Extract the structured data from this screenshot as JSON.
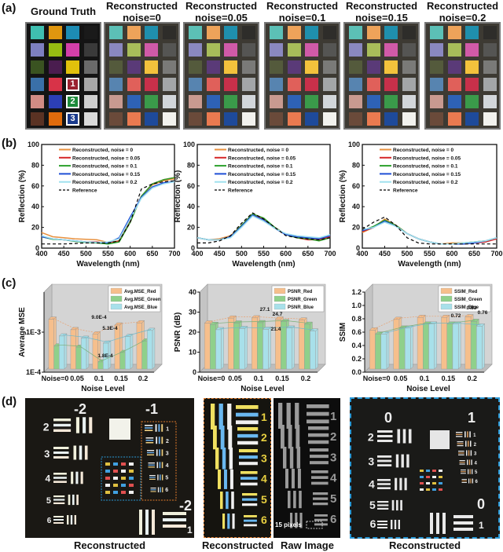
{
  "panels": {
    "a": {
      "label": "(a)",
      "headers": [
        {
          "line1": "Ground Truth",
          "line2": ""
        },
        {
          "line1": "Reconstructed",
          "line2": "noise=0"
        },
        {
          "line1": "Reconstructed",
          "line2": "noise=0.05"
        },
        {
          "line1": "Reconstructed",
          "line2": "noise=0.1"
        },
        {
          "line1": "Reconstructed",
          "line2": "noise=0.15"
        },
        {
          "line1": "Reconstructed",
          "line2": "noise=0.2"
        }
      ],
      "ground_truth_patches": [
        [
          "#3fbfb0",
          "#e0960f",
          "#1d8cb4",
          "#1a1a1a"
        ],
        [
          "#7d7fc0",
          "#96bd12",
          "#d33fa9",
          "#3a3a3a"
        ],
        [
          "#3a5321",
          "#4a1d4f",
          "#e1c10c",
          "#6a6a6a"
        ],
        [
          "#3a70a8",
          "#d83348",
          "#9a2230",
          "#a8a8a8"
        ],
        [
          "#d18b84",
          "#2c3fb5",
          "#1d8a3a",
          "#cfcfcf"
        ],
        [
          "#5a3223",
          "#e06b0c",
          "#1a3a8c",
          "#dadada"
        ]
      ],
      "reconstructed_patches": [
        [
          "#5cc0b6",
          "#eea35a",
          "#1f8fad",
          "#2e2d2a"
        ],
        [
          "#8a88c0",
          "#a8bd5a",
          "#d05aa8",
          "#555553"
        ],
        [
          "#545a3c",
          "#5a3a78",
          "#f3c23c",
          "#7a7a78"
        ],
        [
          "#5784b0",
          "#e0605a",
          "#c8304a",
          "#a3a6a8"
        ],
        [
          "#c89a90",
          "#2e62b6",
          "#3a9a4a",
          "#d2d6da"
        ],
        [
          "#6a4a3a",
          "#ea7a50",
          "#1e4a9a",
          "#f2f2ee"
        ]
      ],
      "numbered_patches": [
        {
          "num": "1",
          "color": "#9a2230"
        },
        {
          "num": "2",
          "color": "#1d8a3a"
        },
        {
          "num": "3",
          "color": "#1a3a8c"
        }
      ]
    },
    "b": {
      "label": "(b)"
    },
    "c": {
      "label": "(c)"
    },
    "d": {
      "label": "(d)",
      "captions": [
        "Reconstructed",
        "Reconstructed",
        "Raw Image",
        "Reconstructed"
      ],
      "scale_bar_label": "15 pixels",
      "main_group_labels": {
        "top_left": "-2",
        "top_right": "-1",
        "bottom_right": "-2",
        "bottom_right_sub": "1"
      },
      "element_numbers_left": [
        "2",
        "3",
        "4",
        "5",
        "6"
      ],
      "element_numbers_right": [
        "1",
        "2",
        "3",
        "4",
        "5",
        "6"
      ],
      "zoom_group_labels": {
        "top_left": "0",
        "top_right": "1",
        "bottom_right": "0",
        "bottom_right_sub": "1"
      },
      "colors": {
        "orange_box": "#e07a2a",
        "blue_box": "#2a9ad8"
      }
    }
  },
  "chart_data": [
    {
      "type": "line",
      "title": "",
      "xlabel": "Wavelength (nm)",
      "ylabel": "Reflection (%)",
      "xlim": [
        400,
        700
      ],
      "ylim": [
        0,
        100
      ],
      "xticks": [
        400,
        450,
        500,
        550,
        600,
        650,
        700
      ],
      "yticks": [
        0,
        20,
        40,
        60,
        80,
        100
      ],
      "legend_position": "top-left",
      "x": [
        400,
        425,
        450,
        475,
        500,
        525,
        550,
        575,
        600,
        625,
        650,
        675,
        700
      ],
      "series": [
        {
          "name": "Reconstructed, noise = 0",
          "color": "#e8913f",
          "dash": false,
          "values": [
            15,
            11,
            10,
            9,
            8.5,
            8,
            5.5,
            7,
            25,
            50,
            61,
            65,
            67
          ]
        },
        {
          "name": "Reconstructed, noise = 0.05",
          "color": "#d62728",
          "dash": false,
          "values": [
            11,
            9,
            8,
            7,
            6,
            6,
            4.5,
            7,
            26,
            50,
            62,
            66,
            68
          ]
        },
        {
          "name": "Reconstructed, noise = 0.1",
          "color": "#2ca02c",
          "dash": false,
          "values": [
            11,
            8.5,
            8,
            6.5,
            5.5,
            5,
            4,
            6,
            25,
            50,
            62,
            66,
            68
          ]
        },
        {
          "name": "Reconstructed, noise = 0.15",
          "color": "#1f4fd6",
          "dash": false,
          "values": [
            11,
            9,
            8,
            7,
            6,
            5.5,
            5,
            10,
            30,
            49,
            59,
            63,
            64
          ]
        },
        {
          "name": "Reconstructed, noise = 0.2",
          "color": "#9fe0ee",
          "dash": false,
          "values": [
            12,
            9,
            8,
            7,
            6,
            5.5,
            6,
            9,
            28,
            48,
            58,
            62,
            64
          ]
        },
        {
          "name": "Reference",
          "color": "#000000",
          "dash": true,
          "values": [
            4,
            4,
            4,
            4.5,
            5,
            5,
            5,
            7,
            25,
            57,
            62,
            64,
            65
          ]
        }
      ]
    },
    {
      "type": "line",
      "title": "",
      "xlabel": "Wavelength (nm)",
      "ylabel": "Reflection (%)",
      "xlim": [
        400,
        700
      ],
      "ylim": [
        0,
        100
      ],
      "xticks": [
        400,
        450,
        500,
        550,
        600,
        650,
        700
      ],
      "yticks": [
        0,
        20,
        40,
        60,
        80,
        100
      ],
      "legend_position": "top-left",
      "x": [
        400,
        425,
        450,
        475,
        500,
        525,
        550,
        575,
        600,
        625,
        650,
        675,
        700
      ],
      "series": [
        {
          "name": "Reconstructed, noise = 0",
          "color": "#e8913f",
          "dash": false,
          "values": [
            10,
            8,
            9,
            12,
            22,
            33,
            28,
            20,
            13,
            10,
            9,
            8,
            11
          ]
        },
        {
          "name": "Reconstructed, noise = 0.05",
          "color": "#d62728",
          "dash": false,
          "values": [
            10,
            8,
            8,
            11,
            22,
            33,
            28,
            20,
            13,
            10,
            8,
            8,
            11
          ]
        },
        {
          "name": "Reconstructed, noise = 0.1",
          "color": "#2ca02c",
          "dash": false,
          "values": [
            10,
            8,
            8,
            11,
            22,
            33,
            29,
            20,
            13,
            10,
            9,
            7,
            10
          ]
        },
        {
          "name": "Reconstructed, noise = 0.15",
          "color": "#1f4fd6",
          "dash": false,
          "values": [
            10,
            8,
            8,
            11,
            21,
            32,
            27,
            19,
            13,
            11,
            10,
            9,
            12
          ]
        },
        {
          "name": "Reconstructed, noise = 0.2",
          "color": "#9fe0ee",
          "dash": false,
          "values": [
            10,
            8,
            8,
            10,
            20,
            31,
            26,
            19,
            14,
            12,
            11,
            10,
            13
          ]
        },
        {
          "name": "Reference",
          "color": "#000000",
          "dash": true,
          "values": [
            5,
            5,
            7,
            12,
            24,
            34,
            28,
            20,
            12,
            10,
            9,
            8,
            10
          ]
        }
      ]
    },
    {
      "type": "line",
      "title": "",
      "xlabel": "Wavelength (nm)",
      "ylabel": "Reflection (%)",
      "xlim": [
        400,
        700
      ],
      "ylim": [
        0,
        100
      ],
      "xticks": [
        400,
        450,
        500,
        550,
        600,
        650,
        700
      ],
      "yticks": [
        0,
        20,
        40,
        60,
        80,
        100
      ],
      "legend_position": "top-left",
      "x": [
        400,
        425,
        450,
        475,
        500,
        525,
        550,
        575,
        600,
        625,
        650,
        675,
        700
      ],
      "series": [
        {
          "name": "Reconstructed, noise = 0",
          "color": "#e8913f",
          "dash": false,
          "values": [
            15,
            20,
            28,
            22,
            14,
            9,
            6,
            4,
            5,
            5,
            6,
            7,
            9
          ]
        },
        {
          "name": "Reconstructed, noise = 0.05",
          "color": "#d62728",
          "dash": false,
          "values": [
            16,
            20,
            27,
            22,
            14,
            9,
            6,
            4,
            4,
            4,
            5,
            6,
            9
          ]
        },
        {
          "name": "Reconstructed, noise = 0.1",
          "color": "#2ca02c",
          "dash": false,
          "values": [
            17,
            21,
            27,
            22,
            14,
            9,
            6,
            4,
            4,
            5,
            6,
            7,
            10
          ]
        },
        {
          "name": "Reconstructed, noise = 0.15",
          "color": "#1f4fd6",
          "dash": false,
          "values": [
            17,
            20,
            26,
            21,
            14,
            9,
            6,
            4,
            4,
            4,
            5,
            7,
            10
          ]
        },
        {
          "name": "Reconstructed, noise = 0.2",
          "color": "#9fe0ee",
          "dash": false,
          "values": [
            18,
            20,
            25,
            21,
            14,
            9,
            6,
            4,
            4,
            5,
            6,
            7,
            10
          ]
        },
        {
          "name": "Reference",
          "color": "#000000",
          "dash": true,
          "values": [
            18,
            25,
            30,
            22,
            10,
            5,
            4,
            4,
            4,
            4,
            4,
            4,
            4
          ]
        }
      ]
    },
    {
      "type": "bar",
      "title": "",
      "xlabel": "Noise Level",
      "ylabel": "Average MSE",
      "yscale": "log",
      "ylim": [
        0.0001,
        0.01
      ],
      "yticks": [
        "1E-4",
        "1E-3"
      ],
      "categories": [
        "Noise=0",
        "0.05",
        "0.1",
        "0.15",
        "0.2"
      ],
      "legend_position": "top-right",
      "series": [
        {
          "name": "Avg.MSE_Red",
          "color": "#f6bf8c",
          "values": [
            0.0021,
            0.00115,
            0.0009,
            0.0015,
            0.0017
          ]
        },
        {
          "name": "Avg.MSE_Green",
          "color": "#8fd08b",
          "values": [
            0.00045,
            0.00042,
            0.00018,
            0.00031,
            0.0006
          ]
        },
        {
          "name": "Avg.MSE_Blue",
          "color": "#a8e0ea",
          "values": [
            0.0008,
            0.0007,
            0.00053,
            0.00078,
            0.0011
          ]
        }
      ],
      "annotations": [
        "9.0E-4",
        "5.3E-4",
        "1.8E-4"
      ]
    },
    {
      "type": "bar",
      "title": "",
      "xlabel": "Noise Level",
      "ylabel": "PSNR (dB)",
      "ylim": [
        0,
        40
      ],
      "yticks": [
        0,
        10,
        20,
        30,
        40
      ],
      "categories": [
        "Noise=0",
        "0.05",
        "0.1",
        "0.15",
        "0.2"
      ],
      "legend_position": "top-right",
      "series": [
        {
          "name": "PSNR_Red",
          "color": "#f6bf8c",
          "values": [
            24.5,
            27.0,
            27.1,
            26.5,
            26.0
          ]
        },
        {
          "name": "PSNR_Green",
          "color": "#8fd08b",
          "values": [
            23.8,
            24.5,
            24.7,
            25.2,
            23.9
          ]
        },
        {
          "name": "PSNR_Blue",
          "color": "#a8e0ea",
          "values": [
            21.2,
            21.8,
            21.4,
            22.0,
            20.5
          ]
        }
      ],
      "annotations": [
        "27.1",
        "24.7",
        "21.4"
      ]
    },
    {
      "type": "bar",
      "title": "",
      "xlabel": "Noise Level",
      "ylabel": "SSIM",
      "ylim": [
        0,
        1.2
      ],
      "yticks": [
        0.0,
        0.2,
        0.4,
        0.6,
        0.8,
        1.0,
        1.2
      ],
      "categories": [
        "Noise=0",
        "0.05",
        "0.1",
        "0.15",
        "0.2"
      ],
      "legend_position": "top-right",
      "series": [
        {
          "name": "SSIM_Red",
          "color": "#f6bf8c",
          "values": [
            0.63,
            0.79,
            0.82,
            0.82,
            0.83
          ]
        },
        {
          "name": "SSIM_Green",
          "color": "#8fd08b",
          "values": [
            0.57,
            0.66,
            0.72,
            0.72,
            0.76
          ]
        },
        {
          "name": "SSIM_Blue",
          "color": "#a8e0ea",
          "values": [
            0.57,
            0.66,
            0.72,
            0.72,
            0.69
          ]
        }
      ],
      "annotations": [
        "0.72",
        "0.83",
        "0.76"
      ]
    }
  ]
}
